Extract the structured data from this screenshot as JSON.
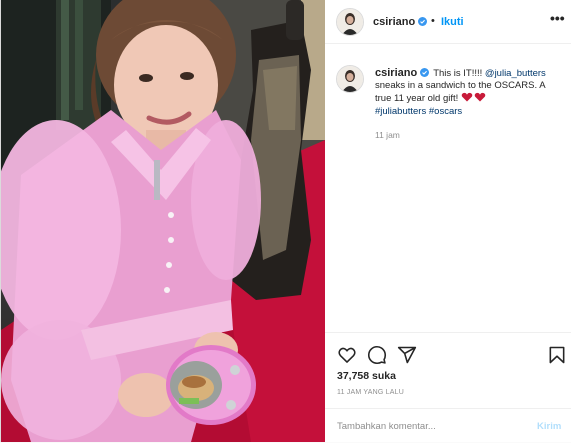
{
  "header": {
    "username": "csiriano",
    "separator": "•",
    "follow_label": "Ikuti",
    "more_label": "•••"
  },
  "caption": {
    "username": "csiriano",
    "text_before": "This is IT!!!! ",
    "mention": "@julia_butters",
    "text_after": " sneaks in a sandwich to the OSCARS. A true 11 year old gift! ",
    "hashtag1": "#juliabutters",
    "hashtag2": "#oscars",
    "time": "11 jam"
  },
  "actions": {
    "like_icon": "heart-outline-icon",
    "comment_icon": "comment-bubble-icon",
    "share_icon": "paper-plane-icon",
    "save_icon": "bookmark-icon",
    "likes_count": "37,758 suka",
    "posted_ago": "11 JAM YANG LALU"
  },
  "comment": {
    "placeholder": "Tambahkan komentar...",
    "post_label": "Kirim"
  },
  "colors": {
    "link": "#00376b",
    "follow": "#0095f6",
    "post_disabled": "#b2dffc",
    "verified": "#3897f0",
    "emoji_heart": "#c81b3a"
  }
}
